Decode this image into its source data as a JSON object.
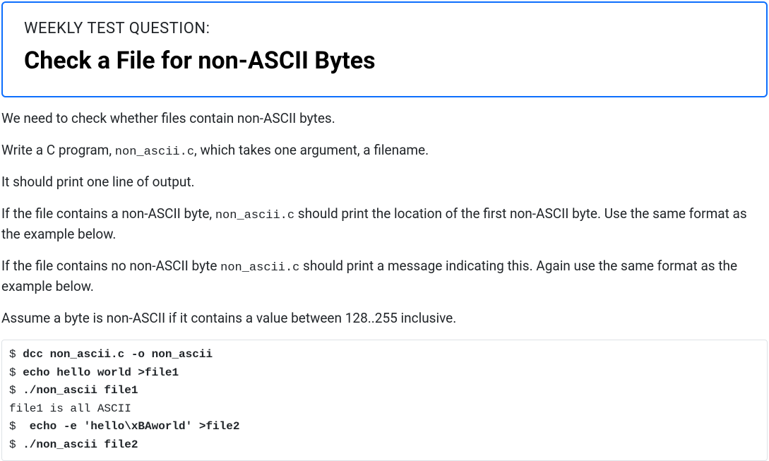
{
  "header": {
    "label": "WEEKLY TEST QUESTION:",
    "title": "Check a File for non-ASCII Bytes"
  },
  "paragraphs": {
    "p1": "We need to check whether files contain non-ASCII bytes.",
    "p2a": "Write a C program, ",
    "p2code": "non_ascii.c",
    "p2b": ", which takes one argument, a filename.",
    "p3": "It should print one line of output.",
    "p4a": "If the file contains a non-ASCII byte, ",
    "p4code": "non_ascii.c",
    "p4b": " should print the location of the first non-ASCII byte. Use the same format as the example below.",
    "p5a": "If the file contains no non-ASCII byte ",
    "p5code": "non_ascii.c",
    "p5b": " should print a message indicating this. Again use the same format as the example below.",
    "p6": "Assume a byte is non-ASCII if it contains a value between 128..255 inclusive."
  },
  "terminal": {
    "prompt": "$",
    "lines": [
      {
        "type": "cmd",
        "text": "dcc non_ascii.c -o non_ascii"
      },
      {
        "type": "cmd",
        "text": "echo hello world >file1"
      },
      {
        "type": "cmd",
        "text": "./non_ascii file1"
      },
      {
        "type": "out",
        "text": "file1 is all ASCII"
      },
      {
        "type": "cmd",
        "text": " echo -e 'hello\\xBAworld' >file2"
      },
      {
        "type": "cmd",
        "text": "./non_ascii file2"
      }
    ]
  }
}
